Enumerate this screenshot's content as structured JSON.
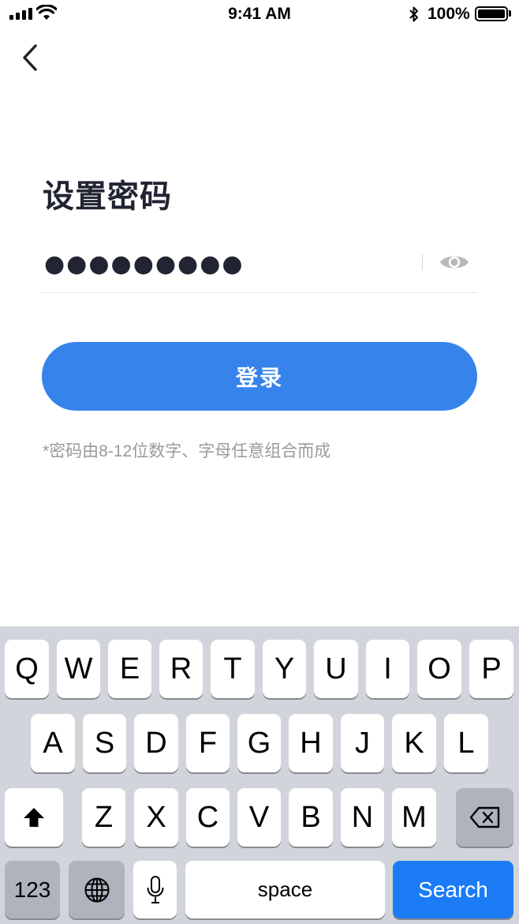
{
  "status_bar": {
    "time": "9:41 AM",
    "battery": "100%"
  },
  "page": {
    "title": "设置密码",
    "password_masked": "●●●●●●●●●",
    "login_label": "登录",
    "hint": "*密码由8-12位数字、字母任意组合而成"
  },
  "keyboard": {
    "row1": [
      "Q",
      "W",
      "E",
      "R",
      "T",
      "Y",
      "U",
      "I",
      "O",
      "P"
    ],
    "row2": [
      "A",
      "S",
      "D",
      "F",
      "G",
      "H",
      "J",
      "K",
      "L"
    ],
    "row3": [
      "Z",
      "X",
      "C",
      "V",
      "B",
      "N",
      "M"
    ],
    "numbers_label": "123",
    "space_label": "space",
    "search_label": "Search"
  },
  "colors": {
    "accent": "#3683ec",
    "search_key": "#1b7cf6",
    "keyboard_bg": "#d1d5db"
  },
  "icons": [
    "signal-icon",
    "wifi-icon",
    "bluetooth-icon",
    "battery-icon",
    "back-arrow-icon",
    "eye-icon",
    "shift-icon",
    "backspace-icon",
    "globe-icon",
    "microphone-icon"
  ]
}
